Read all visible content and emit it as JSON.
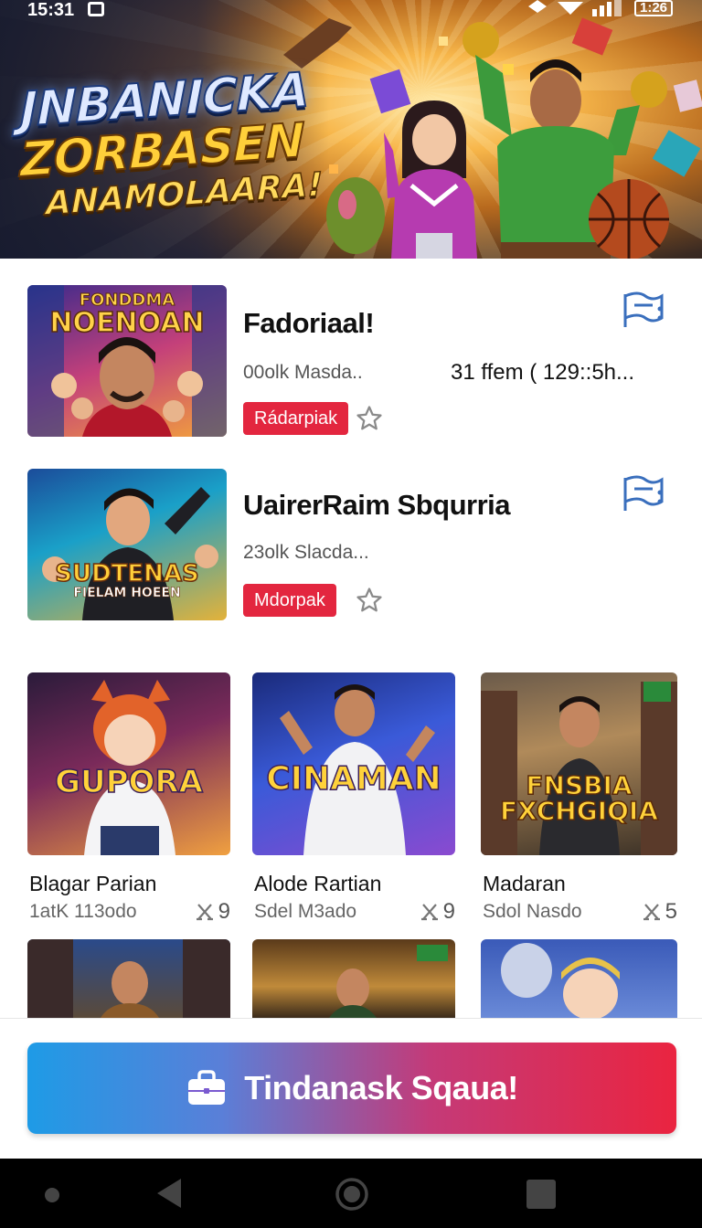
{
  "status_bar": {
    "time": "15:31",
    "battery": "1:26"
  },
  "hero": {
    "line1": "JNBANICKA",
    "line2": "ZORBASEN",
    "line3": "ANAMOLAARA!"
  },
  "featured": [
    {
      "thumb_caption_top": "FONDDMA",
      "thumb_caption_main": "NOENOAN",
      "title": "Fadoriaal!",
      "subtitle": "00olk Masda..",
      "meta": "31 ffem ( 129::5h...",
      "badge": "Rádarpiak",
      "icon": "playlist-flag-icon"
    },
    {
      "thumb_caption_top": "SUDTENAS",
      "thumb_caption_main": "FIELAM HOEEN",
      "title": "UairerRaim Sbqurria",
      "subtitle": "23olk Slacda...",
      "meta": "",
      "badge": "Mdorpak",
      "icon": "playlist-flag-icon"
    }
  ],
  "grid": [
    {
      "caption": "GUPORA",
      "title": "Blagar Parian",
      "subtitle": "1atK 113odo",
      "count": "9"
    },
    {
      "caption": "CINAMAN",
      "title": "Alode Rartian",
      "subtitle": "Sdel M3ado",
      "count": "9"
    },
    {
      "caption": "FNSBIA FXCHGIQIA",
      "title": "Madaran",
      "subtitle": "Sdol Nasdo",
      "count": "5"
    }
  ],
  "cta": {
    "label": "Tindanask Sqaua!",
    "icon": "shopping-bag-icon"
  },
  "colors": {
    "accent_red": "#e3263f",
    "cta_gradient_start": "#1e9be6",
    "cta_gradient_end": "#ea2440",
    "icon_blue": "#3a6fbd"
  }
}
